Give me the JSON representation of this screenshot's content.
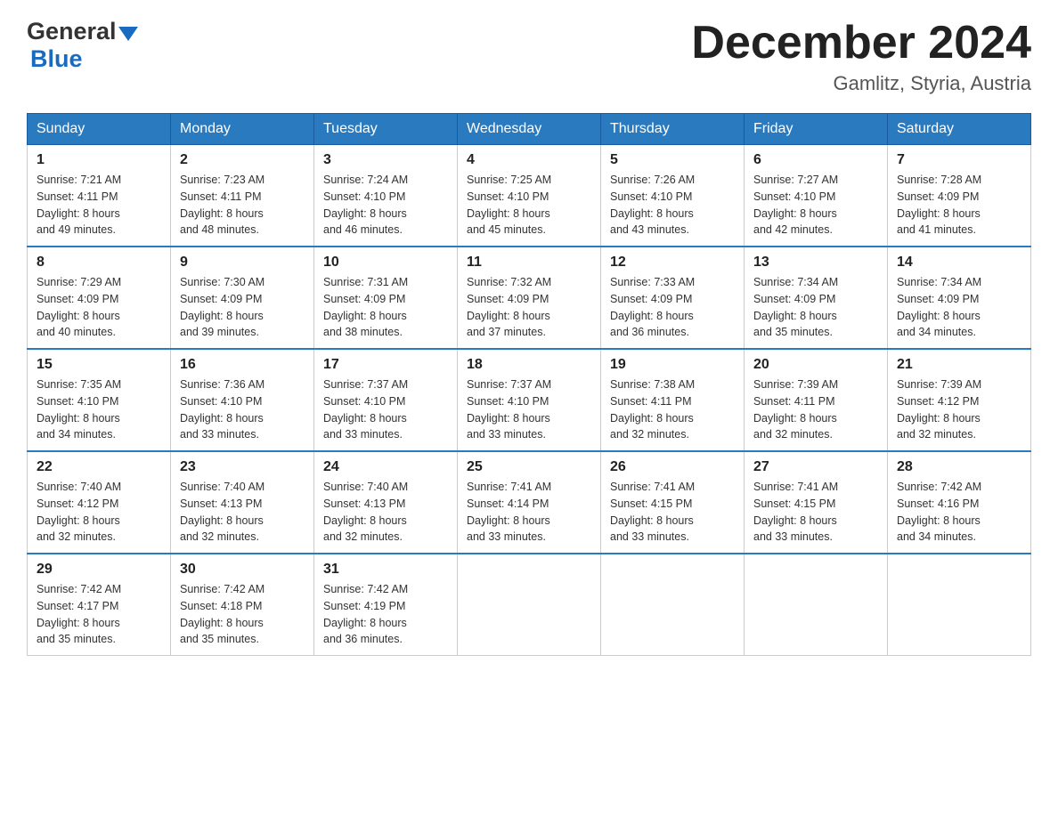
{
  "logo": {
    "general": "General",
    "blue": "Blue"
  },
  "title": {
    "month": "December 2024",
    "location": "Gamlitz, Styria, Austria"
  },
  "days_header": [
    "Sunday",
    "Monday",
    "Tuesday",
    "Wednesday",
    "Thursday",
    "Friday",
    "Saturday"
  ],
  "weeks": [
    [
      {
        "day": "1",
        "sunrise": "7:21 AM",
        "sunset": "4:11 PM",
        "daylight": "8 hours and 49 minutes."
      },
      {
        "day": "2",
        "sunrise": "7:23 AM",
        "sunset": "4:11 PM",
        "daylight": "8 hours and 48 minutes."
      },
      {
        "day": "3",
        "sunrise": "7:24 AM",
        "sunset": "4:10 PM",
        "daylight": "8 hours and 46 minutes."
      },
      {
        "day": "4",
        "sunrise": "7:25 AM",
        "sunset": "4:10 PM",
        "daylight": "8 hours and 45 minutes."
      },
      {
        "day": "5",
        "sunrise": "7:26 AM",
        "sunset": "4:10 PM",
        "daylight": "8 hours and 43 minutes."
      },
      {
        "day": "6",
        "sunrise": "7:27 AM",
        "sunset": "4:10 PM",
        "daylight": "8 hours and 42 minutes."
      },
      {
        "day": "7",
        "sunrise": "7:28 AM",
        "sunset": "4:09 PM",
        "daylight": "8 hours and 41 minutes."
      }
    ],
    [
      {
        "day": "8",
        "sunrise": "7:29 AM",
        "sunset": "4:09 PM",
        "daylight": "8 hours and 40 minutes."
      },
      {
        "day": "9",
        "sunrise": "7:30 AM",
        "sunset": "4:09 PM",
        "daylight": "8 hours and 39 minutes."
      },
      {
        "day": "10",
        "sunrise": "7:31 AM",
        "sunset": "4:09 PM",
        "daylight": "8 hours and 38 minutes."
      },
      {
        "day": "11",
        "sunrise": "7:32 AM",
        "sunset": "4:09 PM",
        "daylight": "8 hours and 37 minutes."
      },
      {
        "day": "12",
        "sunrise": "7:33 AM",
        "sunset": "4:09 PM",
        "daylight": "8 hours and 36 minutes."
      },
      {
        "day": "13",
        "sunrise": "7:34 AM",
        "sunset": "4:09 PM",
        "daylight": "8 hours and 35 minutes."
      },
      {
        "day": "14",
        "sunrise": "7:34 AM",
        "sunset": "4:09 PM",
        "daylight": "8 hours and 34 minutes."
      }
    ],
    [
      {
        "day": "15",
        "sunrise": "7:35 AM",
        "sunset": "4:10 PM",
        "daylight": "8 hours and 34 minutes."
      },
      {
        "day": "16",
        "sunrise": "7:36 AM",
        "sunset": "4:10 PM",
        "daylight": "8 hours and 33 minutes."
      },
      {
        "day": "17",
        "sunrise": "7:37 AM",
        "sunset": "4:10 PM",
        "daylight": "8 hours and 33 minutes."
      },
      {
        "day": "18",
        "sunrise": "7:37 AM",
        "sunset": "4:10 PM",
        "daylight": "8 hours and 33 minutes."
      },
      {
        "day": "19",
        "sunrise": "7:38 AM",
        "sunset": "4:11 PM",
        "daylight": "8 hours and 32 minutes."
      },
      {
        "day": "20",
        "sunrise": "7:39 AM",
        "sunset": "4:11 PM",
        "daylight": "8 hours and 32 minutes."
      },
      {
        "day": "21",
        "sunrise": "7:39 AM",
        "sunset": "4:12 PM",
        "daylight": "8 hours and 32 minutes."
      }
    ],
    [
      {
        "day": "22",
        "sunrise": "7:40 AM",
        "sunset": "4:12 PM",
        "daylight": "8 hours and 32 minutes."
      },
      {
        "day": "23",
        "sunrise": "7:40 AM",
        "sunset": "4:13 PM",
        "daylight": "8 hours and 32 minutes."
      },
      {
        "day": "24",
        "sunrise": "7:40 AM",
        "sunset": "4:13 PM",
        "daylight": "8 hours and 32 minutes."
      },
      {
        "day": "25",
        "sunrise": "7:41 AM",
        "sunset": "4:14 PM",
        "daylight": "8 hours and 33 minutes."
      },
      {
        "day": "26",
        "sunrise": "7:41 AM",
        "sunset": "4:15 PM",
        "daylight": "8 hours and 33 minutes."
      },
      {
        "day": "27",
        "sunrise": "7:41 AM",
        "sunset": "4:15 PM",
        "daylight": "8 hours and 33 minutes."
      },
      {
        "day": "28",
        "sunrise": "7:42 AM",
        "sunset": "4:16 PM",
        "daylight": "8 hours and 34 minutes."
      }
    ],
    [
      {
        "day": "29",
        "sunrise": "7:42 AM",
        "sunset": "4:17 PM",
        "daylight": "8 hours and 35 minutes."
      },
      {
        "day": "30",
        "sunrise": "7:42 AM",
        "sunset": "4:18 PM",
        "daylight": "8 hours and 35 minutes."
      },
      {
        "day": "31",
        "sunrise": "7:42 AM",
        "sunset": "4:19 PM",
        "daylight": "8 hours and 36 minutes."
      },
      null,
      null,
      null,
      null
    ]
  ],
  "labels": {
    "sunrise": "Sunrise:",
    "sunset": "Sunset:",
    "daylight": "Daylight:"
  }
}
